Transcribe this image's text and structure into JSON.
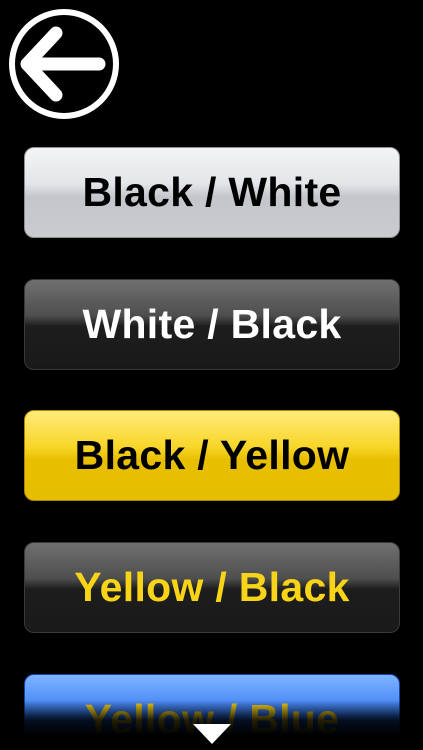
{
  "icons": {
    "back": "arrow-left-icon",
    "scroll": "chevron-down-icon"
  },
  "colors": {
    "background": "#000000",
    "yellow_text": "#f7d417",
    "white": "#ffffff"
  },
  "buttons": [
    {
      "label": "Black / White",
      "text_color": "#000000",
      "bg_color": "#d4d6da"
    },
    {
      "label": "White / Black",
      "text_color": "#ffffff",
      "bg_color": "#1d1d1d"
    },
    {
      "label": "Black / Yellow",
      "text_color": "#000000",
      "bg_color": "#f0c800"
    },
    {
      "label": "Yellow / Black",
      "text_color": "#f7d417",
      "bg_color": "#1d1d1d"
    },
    {
      "label": "Yellow / Blue",
      "text_color": "#f7d417",
      "bg_color": "#2a6ef0"
    }
  ]
}
